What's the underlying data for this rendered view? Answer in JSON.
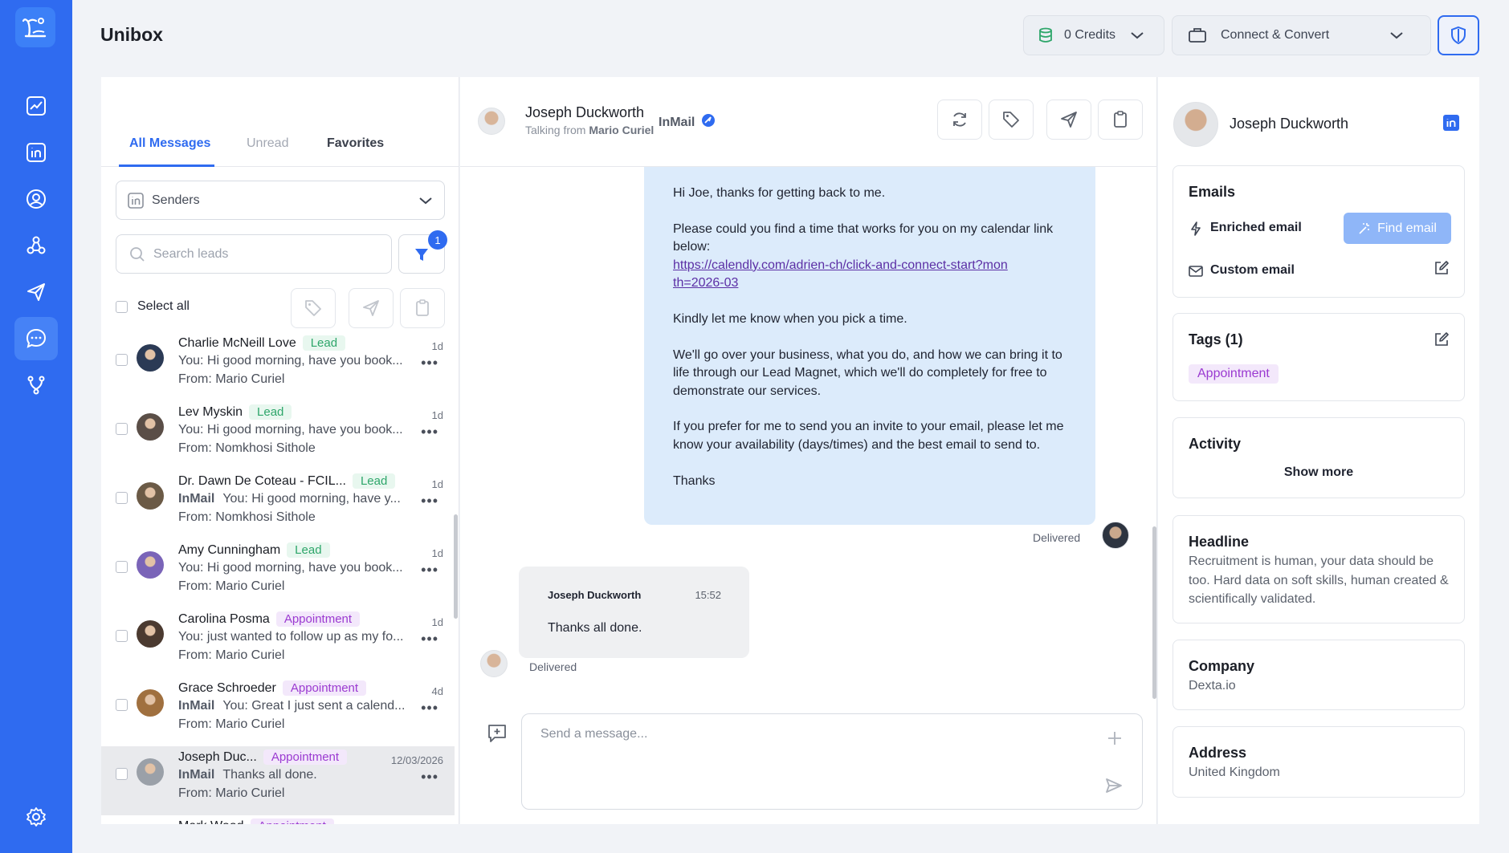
{
  "app": {
    "title": "Unibox"
  },
  "topbar": {
    "credits_label": "0 Credits",
    "connect_label": "Connect & Convert"
  },
  "nav": [
    "analytics-icon",
    "linkedin-icon",
    "user-circle-icon",
    "network-icon",
    "send-icon",
    "chat-icon",
    "flow-icon",
    "settings-icon"
  ],
  "colors": {
    "brand": "#2f6bf0",
    "lead": "#2ea66a",
    "appointment": "#9b3ad1",
    "bubble": "#dcebfb"
  },
  "inbox": {
    "tabs": [
      "All Messages",
      "Unread",
      "Favorites"
    ],
    "senders_label": "Senders",
    "search_placeholder": "Search leads",
    "filter_count": "1",
    "select_all": "Select all",
    "conversations": [
      {
        "name": "Charlie McNeill Love",
        "tag": "Lead",
        "tag_type": "lead",
        "inmail": "",
        "message": "You: Hi good morning, have you book...",
        "from": "From: Mario Curiel",
        "time": "1d",
        "avatar": "#2b3a55",
        "selected": false
      },
      {
        "name": "Lev Myskin",
        "tag": "Lead",
        "tag_type": "lead",
        "inmail": "",
        "message": "You: Hi good morning, have you book...",
        "from": "From: Nomkhosi Sithole",
        "time": "1d",
        "avatar": "#5a4e47",
        "selected": false
      },
      {
        "name": "Dr. Dawn De Coteau - FCIL...",
        "tag": "Lead",
        "tag_type": "lead",
        "inmail": "InMail",
        "message": "You: Hi good morning, have y...",
        "from": "From: Nomkhosi Sithole",
        "time": "1d",
        "avatar": "#6b5a46",
        "selected": false
      },
      {
        "name": "Amy Cunningham",
        "tag": "Lead",
        "tag_type": "lead",
        "inmail": "",
        "message": "You: Hi good morning, have you book...",
        "from": "From: Mario Curiel",
        "time": "1d",
        "avatar": "#7a64b8",
        "selected": false
      },
      {
        "name": "Carolina Posma",
        "tag": "Appointment",
        "tag_type": "appt",
        "inmail": "",
        "message": "You: just wanted to follow up as my fo...",
        "from": "From: Mario Curiel",
        "time": "1d",
        "avatar": "#4b3a30",
        "selected": false
      },
      {
        "name": "Grace Schroeder",
        "tag": "Appointment",
        "tag_type": "appt",
        "inmail": "InMail",
        "message": "You: Great I just sent a calend...",
        "from": "From: Mario Curiel",
        "time": "4d",
        "avatar": "#a0703f",
        "selected": false
      },
      {
        "name": "Joseph Duc...",
        "tag": "Appointment",
        "tag_type": "appt",
        "inmail": "InMail",
        "message": "Thanks all done.",
        "from": "From: Mario Curiel",
        "time": "12/03/2026",
        "avatar": "#9aa0a8",
        "selected": true
      },
      {
        "name": "Mark Wood",
        "tag": "Appointment",
        "tag_type": "appt",
        "inmail": "",
        "message": "",
        "from": "",
        "time": "",
        "avatar": "#6d7380",
        "selected": false
      }
    ]
  },
  "chat": {
    "contact_name": "Joseph Duckworth",
    "talking_from": "Talking from",
    "talking_from_name": "Mario Curiel",
    "channel": "InMail",
    "outgoing": {
      "p1": "Hi Joe, thanks for getting back to me.",
      "p2": "Please could you find a time that works for you on my calendar link below:",
      "link": "https://calendly.com/adrien-ch/click-and-connect-start?month=2026-03",
      "p3": "Kindly let me know when you pick a time.",
      "p4": "We'll go over your business, what you do, and how we can bring it to life through our Lead Magnet, which we'll do completely for free to demonstrate our services.",
      "p5": "If you prefer for me to send you an invite to your email, please let me know your availability (days/times) and the best email to send to.",
      "p6": "Thanks",
      "status": "Delivered"
    },
    "incoming": {
      "sender": "Joseph Duckworth",
      "time": "15:52",
      "text": "Thanks all done.",
      "status": "Delivered"
    },
    "composer_placeholder": "Send a message..."
  },
  "profile": {
    "name": "Joseph Duckworth",
    "emails_title": "Emails",
    "enriched_label": "Enriched email",
    "find_email_label": "Find email",
    "custom_label": "Custom email",
    "tags_title": "Tags (1)",
    "tag": "Appointment",
    "activity_title": "Activity",
    "show_more": "Show more",
    "headline_title": "Headline",
    "headline": "Recruitment is human, your data should be too. Hard data on soft skills, human created & scientifically validated.",
    "company_title": "Company",
    "company": "Dexta.io",
    "address_title": "Address",
    "address": "United Kingdom"
  }
}
